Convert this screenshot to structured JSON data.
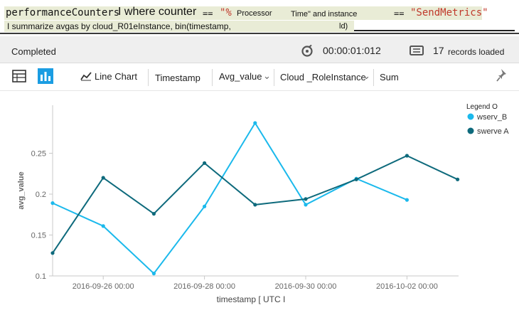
{
  "query": {
    "line1": {
      "table": "performanceCounters",
      "pipe_where": "I where counter",
      "op1": "==",
      "str1_prefix": "\"%",
      "str1_word": "Processor",
      "str1_suffix": "Time\" and instance",
      "op2": "==",
      "str2": "\"SendMetrics\""
    },
    "line2": {
      "summarize": "I summarize avgas by cloud_R01eInstance, bin(timestamp,",
      "tail": "ld)"
    }
  },
  "status": {
    "state": "Completed",
    "elapsed": "00:00:01:012",
    "records_count": "17",
    "records_label": "records loaded"
  },
  "toolbar": {
    "table_icon": "table-icon",
    "chart_icon": "bar-chart-icon",
    "chart_type_label": "Line Chart",
    "x_column": "Timestamp",
    "y_column": "Avg_value",
    "split_by": "Cloud _RoleInstance",
    "aggregation": "Sum",
    "pin_icon": "pin-icon"
  },
  "chart_data": {
    "type": "line",
    "xlabel": "timestamp [ UTC I",
    "ylabel": "avg_value",
    "ylim": [
      0.1,
      0.3
    ],
    "yticks": [
      "0.1",
      "0.15",
      "0.2",
      "0.25"
    ],
    "xticks": [
      "2016-09-26 00:00",
      "2016-09-28 00:00",
      "2016-09-30 00:00",
      "2016-10-02 00:00"
    ],
    "legend_title": "Legend O",
    "legend_position": "top-right",
    "grid": false,
    "series": [
      {
        "name": "wserv_B",
        "color": "#1bb9ec",
        "x": [
          "2016-09-25 00:00",
          "2016-09-26 00:00",
          "2016-09-27 00:00",
          "2016-09-28 00:00",
          "2016-09-29 00:00",
          "2016-09-30 00:00",
          "2016-10-01 00:00",
          "2016-10-02 00:00"
        ],
        "values": [
          0.189,
          0.161,
          0.103,
          0.185,
          0.287,
          0.187,
          0.219,
          0.193
        ]
      },
      {
        "name": "swerve A",
        "color": "#0e6a7c",
        "x": [
          "2016-09-25 00:00",
          "2016-09-26 00:00",
          "2016-09-27 00:00",
          "2016-09-28 00:00",
          "2016-09-29 00:00",
          "2016-09-30 00:00",
          "2016-10-01 00:00",
          "2016-10-02 00:00",
          "2016-10-03 00:00"
        ],
        "values": [
          0.128,
          0.22,
          0.176,
          0.238,
          0.187,
          0.194,
          0.218,
          0.247,
          0.218
        ]
      }
    ]
  }
}
